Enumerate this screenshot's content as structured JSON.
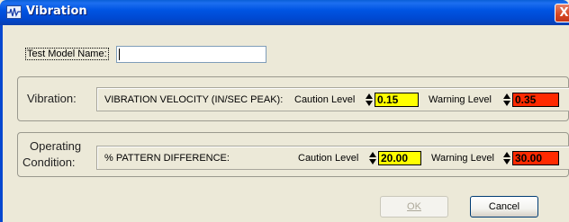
{
  "window": {
    "title": "Vibration",
    "icon": "vibration-app-icon",
    "close_symbol": "X"
  },
  "test_model": {
    "label": "Test Model Name:",
    "value": ""
  },
  "vibration": {
    "group_label": "Vibration:",
    "measure": "VIBRATION VELOCITY (IN/SEC PEAK):",
    "caution_label": "Caution Level",
    "caution_value": "0.15",
    "warning_label": "Warning Level",
    "warning_value": "0.35"
  },
  "operating": {
    "group_label_line1": "Operating",
    "group_label_line2": "Condition:",
    "measure": "% PATTERN DIFFERENCE:",
    "caution_label": "Caution Level",
    "caution_value": "20.00",
    "warning_label": "Warning Level",
    "warning_value": "30.00"
  },
  "buttons": {
    "ok": "OK",
    "cancel": "Cancel"
  },
  "colors": {
    "caution": "#ffff00",
    "warning": "#ff2a00",
    "titlebar": "#0054e3"
  }
}
